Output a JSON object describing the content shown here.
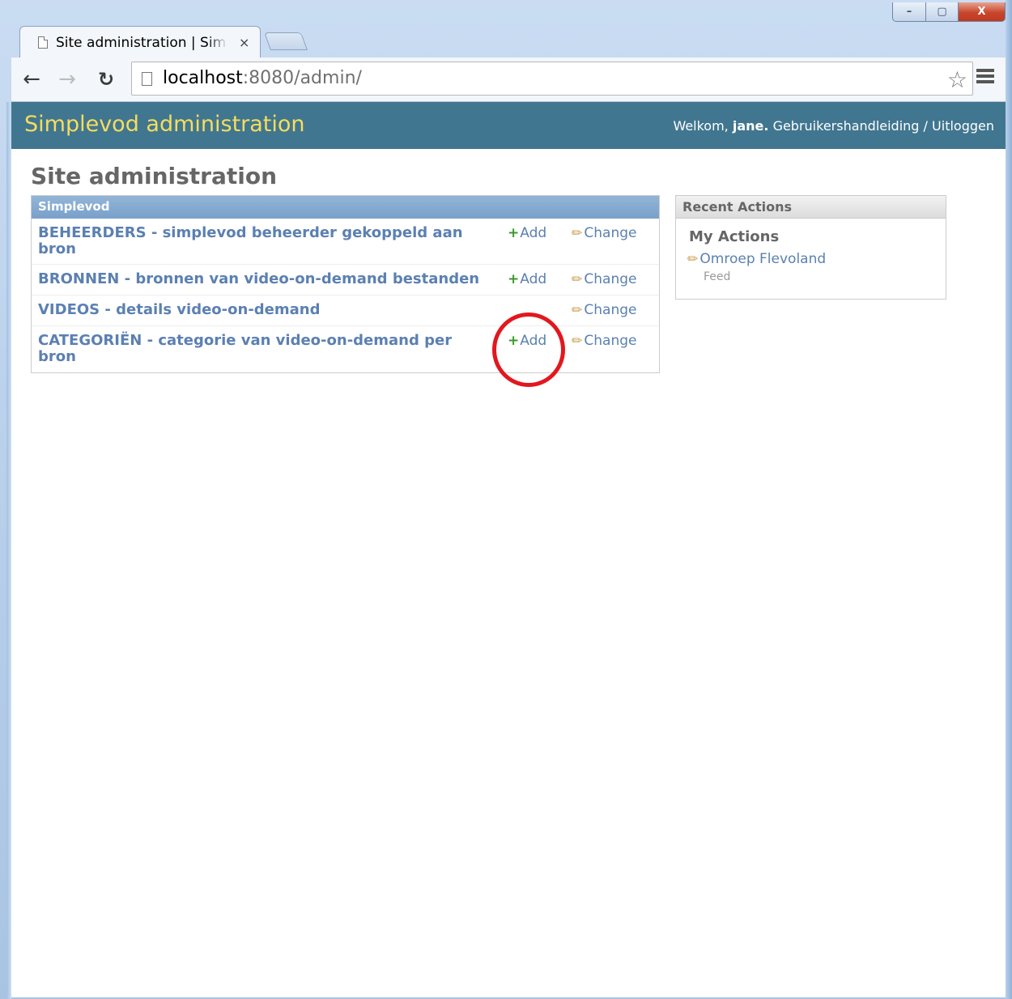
{
  "browser": {
    "tab_title": "Site administration | Simplevod administration",
    "tab_close": "×",
    "url_host": "localhost",
    "url_rest": ":8080/admin/",
    "window_controls": {
      "minimize": "–",
      "maximize": "▢",
      "close": "X"
    }
  },
  "header": {
    "brand": "Simplevod administration",
    "welcome": "Welkom,",
    "user": "jane.",
    "docs_link": "Gebruikershandleiding",
    "separator": "/",
    "logout_link": "Uitloggen"
  },
  "content": {
    "title": "Site administration",
    "module_caption": "Simplevod",
    "models": [
      {
        "name": "BEHEERDERS - simplevod beheerder gekoppeld aan bron",
        "add": "Add",
        "change": "Change"
      },
      {
        "name": "BRONNEN - bronnen van video-on-demand bestanden",
        "add": "Add",
        "change": "Change"
      },
      {
        "name": "VIDEOS - details video-on-demand",
        "add": "",
        "change": "Change"
      },
      {
        "name": "CATEGORIËN - categorie van video-on-demand per bron",
        "add": "Add",
        "change": "Change"
      }
    ]
  },
  "sidebar": {
    "caption": "Recent Actions",
    "my_actions": "My Actions",
    "item_label": "Omroep Flevoland",
    "item_type": "Feed"
  },
  "colors": {
    "header_bg": "#417690",
    "brand": "#f5dd5d",
    "link": "#5b80b2",
    "annotation_circle": "#e3171e"
  }
}
